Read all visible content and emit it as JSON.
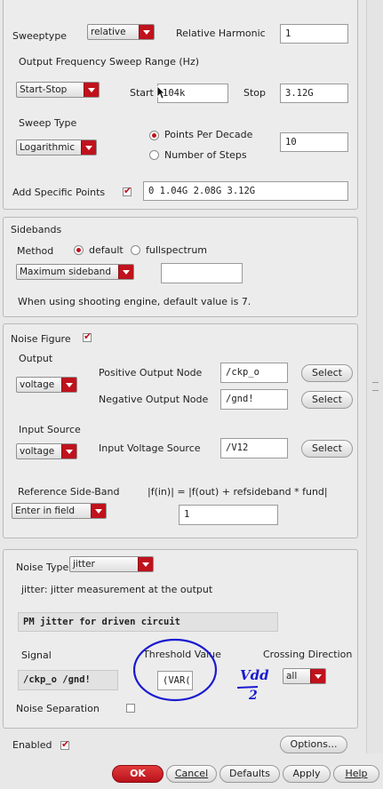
{
  "sweep": {
    "sweeptype_label": "Sweeptype",
    "sweeptype_value": "relative",
    "relative_harmonic_label": "Relative Harmonic",
    "relative_harmonic_value": "1",
    "freq_range_label": "Output Frequency Sweep Range (Hz)",
    "range_mode": "Start-Stop",
    "start_label": "Start",
    "start_value": "104k",
    "stop_label": "Stop",
    "stop_value": "3.12G",
    "sweep_type_label": "Sweep Type",
    "sweep_type_value": "Logarithmic",
    "ppd_label": "Points Per Decade",
    "steps_label": "Number of Steps",
    "ppd_value": "10",
    "add_points_label": "Add Specific Points",
    "add_points_value": "0 1.04G 2.08G 3.12G"
  },
  "sidebands": {
    "title": "Sidebands",
    "method_label": "Method",
    "opt_default": "default",
    "opt_full": "fullspectrum",
    "select_value": "Maximum sideband",
    "field_value": "",
    "note": "When using shooting engine, default value is 7."
  },
  "noise": {
    "noise_figure_label": "Noise Figure",
    "output_label": "Output",
    "output_value": "voltage",
    "pos_node_label": "Positive Output Node",
    "pos_node_value": "/ckp_o",
    "neg_node_label": "Negative Output Node",
    "neg_node_value": "/gnd!",
    "select_label": "Select",
    "input_source_label": "Input Source",
    "input_source_value": "voltage",
    "input_vsrc_label": "Input Voltage Source",
    "input_vsrc_value": "/V12",
    "ref_sideband_label": "Reference Side-Band",
    "formula": "|f(in)| = |f(out) + refsideband * fund|",
    "ref_mode": "Enter in field",
    "ref_value": "1"
  },
  "jitter": {
    "noise_type_label": "Noise Type",
    "noise_type_value": "jitter",
    "description": "jitter: jitter measurement at the output",
    "mode_value": "PM jitter for driven circuit",
    "signal_label": "Signal",
    "signal_value": "/ckp_o /gnd!",
    "threshold_label": "Threshold Value",
    "threshold_value": "(VAR(\"",
    "crossing_label": "Crossing Direction",
    "crossing_value": "all",
    "noise_sep_label": "Noise Separation",
    "annotation_top": "Vdd",
    "annotation_bottom": "2"
  },
  "footer": {
    "enabled_label": "Enabled",
    "options_label": "Options...",
    "ok": "OK",
    "cancel": "Cancel",
    "defaults": "Defaults",
    "apply": "Apply",
    "help": "Help"
  },
  "colors": {
    "accent": "#c0121c",
    "annotation": "#1a1ad0"
  }
}
